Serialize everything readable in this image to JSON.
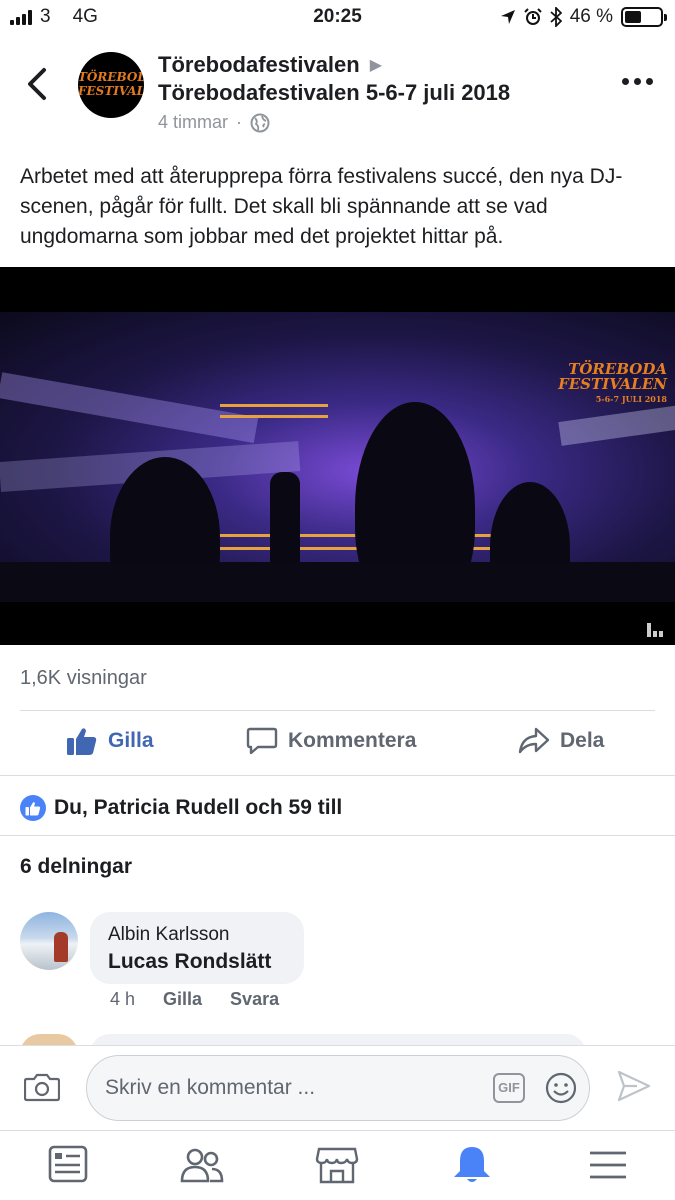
{
  "status_bar": {
    "carrier": "3",
    "network": "4G",
    "time": "20:25",
    "battery_percent": "46 %",
    "battery_level": 0.46
  },
  "post": {
    "page_name": "Törebodafestivalen",
    "event_name": "Törebodafestivalen 5-6-7 juli 2018",
    "time_ago": "4 timmar",
    "separator": "·",
    "avatar_logo_line1": "TÖREBODA",
    "avatar_logo_line2": "FESTIVALEN",
    "text": "Arbetet med att återupprepa förra festivalens succé, den nya DJ-scenen, pågår för fullt. Det skall bli spännande att se vad ungdomarna som jobbar med det projektet hittar på.",
    "video_logo_line1": "TÖREBODA",
    "video_logo_line2": "FESTIVALEN",
    "video_logo_dates": "5-6-7 JULI 2018",
    "views": "1,6K visningar"
  },
  "actions": {
    "like": "Gilla",
    "comment": "Kommentera",
    "share": "Dela"
  },
  "reactions_text": "Du, Patricia Rudell och 59 till",
  "shares_text": "6 delningar",
  "comments": [
    {
      "author": "Albin Karlsson",
      "text": "Lucas Rondslätt",
      "time": "4 h",
      "like": "Gilla",
      "reply": "Svara"
    }
  ],
  "composer": {
    "placeholder": "Skriv en kommentar ...",
    "gif_label": "GIF"
  },
  "tabbar": {
    "items": [
      "news-feed-icon",
      "friends-icon",
      "marketplace-icon",
      "notifications-icon",
      "menu-icon"
    ],
    "active": "notifications-icon",
    "active_color": "#4a82f7"
  },
  "colors": {
    "accent": "#4267b2",
    "like_badge": "#4a82f7",
    "logo": "#e27b1f"
  }
}
